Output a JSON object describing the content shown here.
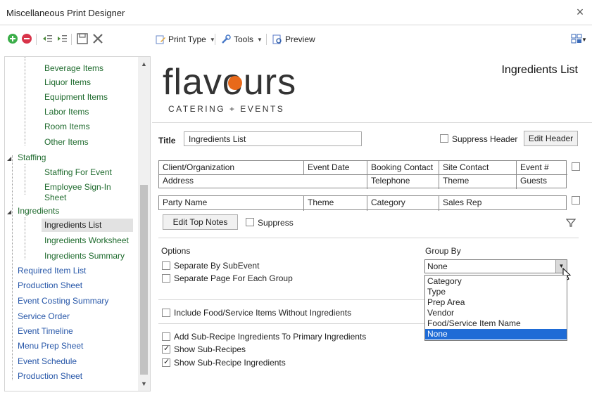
{
  "window": {
    "title": "Miscellaneous Print Designer",
    "close_glyph": "×"
  },
  "toolbar": {
    "print_type": "Print Type",
    "tools": "Tools",
    "preview": "Preview",
    "icons": [
      "add-icon",
      "remove-icon",
      "indent-left-icon",
      "indent-right-icon",
      "save-icon",
      "delete-icon",
      "print-type-icon",
      "tools-icon",
      "preview-icon",
      "layout-icon"
    ]
  },
  "tree": {
    "items": [
      {
        "label": "Beverage Items"
      },
      {
        "label": "Liquor Items"
      },
      {
        "label": "Equipment Items"
      },
      {
        "label": "Labor Items"
      },
      {
        "label": "Room Items"
      },
      {
        "label": "Other Items"
      },
      {
        "label": "Staffing"
      },
      {
        "label": "Staffing For Event"
      },
      {
        "label": "Employee Sign-In Sheet"
      },
      {
        "label": "Ingredients"
      },
      {
        "label": "Ingredients List"
      },
      {
        "label": "Ingredients Worksheet"
      },
      {
        "label": "Ingredients Summary"
      },
      {
        "label": "Required Item List"
      },
      {
        "label": "Production Sheet"
      },
      {
        "label": "Event Costing Summary"
      },
      {
        "label": "Service Order"
      },
      {
        "label": "Event Timeline"
      },
      {
        "label": "Menu Prep Sheet"
      },
      {
        "label": "Event Schedule"
      },
      {
        "label": "Production Sheet"
      }
    ]
  },
  "logo": {
    "brand": "flavours",
    "tagline": "CATERING + EVENTS"
  },
  "document": {
    "heading": "Ingredients List",
    "title_label": "Title",
    "title_value": "Ingredients List",
    "suppress_header_label": "Suppress Header",
    "edit_header_label": "Edit Header",
    "grid1": {
      "r1": [
        "Client/Organization",
        "Event Date",
        "Booking Contact",
        "Site Contact",
        "Event #"
      ],
      "r2": [
        "Address",
        "Telephone",
        "Theme",
        "Guests"
      ]
    },
    "grid2": [
      "Party Name",
      "Theme",
      "Category",
      "Sales Rep"
    ],
    "edit_top_notes_label": "Edit Top Notes",
    "suppress_label": "Suppress"
  },
  "options": {
    "heading": "Options",
    "separate_by_subevent": "Separate By SubEvent",
    "separate_page": "Separate Page For Each Group",
    "include_food": "Include Food/Service Items Without Ingredients",
    "add_sub_recipe": "Add Sub-Recipe Ingredients To Primary Ingredients",
    "show_sub_recipes": "Show Sub-Recipes",
    "show_sub_recipe_ingredients": "Show Sub-Recipe Ingredients"
  },
  "group_by": {
    "label": "Group By",
    "selected": "None",
    "options": [
      "Category",
      "Type",
      "Prep Area",
      "Vendor",
      "Food/Service Item Name",
      "None"
    ]
  },
  "colors": {
    "tree_green": "#1f6b2e",
    "tree_blue": "#2656a8",
    "selection_blue": "#1e6bd6",
    "logo_orange": "#e8691a"
  }
}
